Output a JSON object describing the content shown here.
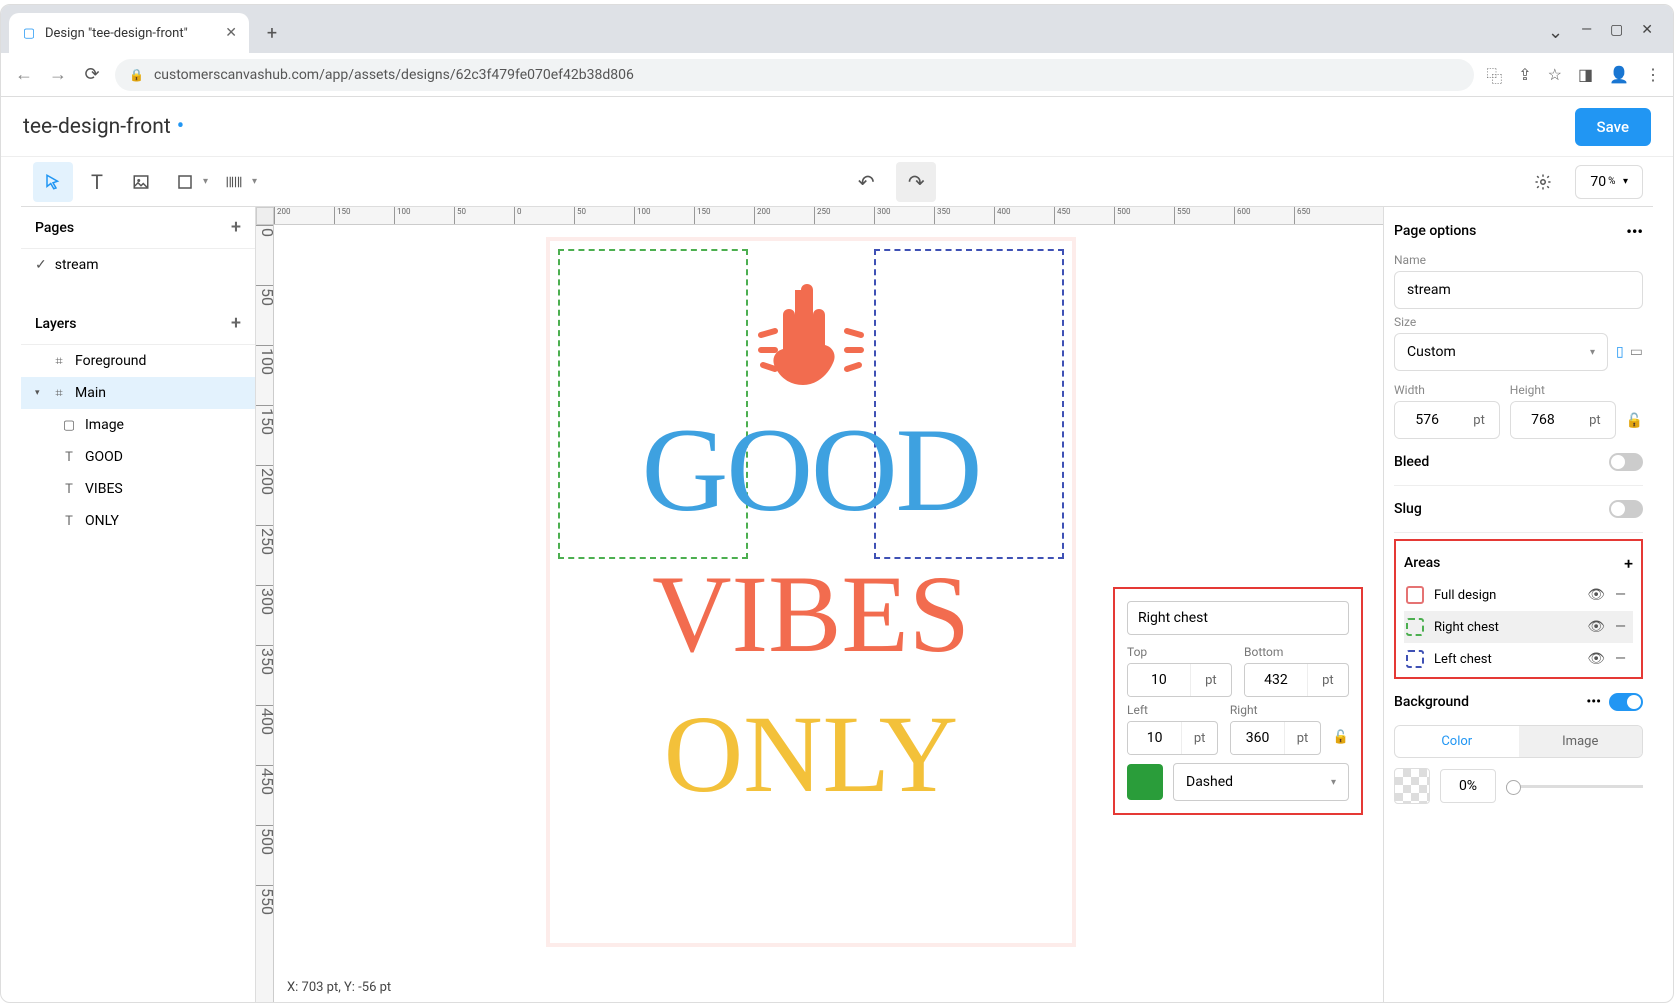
{
  "browser": {
    "tabTitle": "Design \"tee-design-front\"",
    "url": "customerscanvashub.com/app/assets/designs/62c3f479fe070ef42b38d806"
  },
  "header": {
    "title": "tee-design-front",
    "save": "Save"
  },
  "toolbar": {
    "zoom": "70",
    "zoomPct": "%"
  },
  "pagesPanel": {
    "title": "Pages",
    "items": [
      "stream"
    ]
  },
  "layersPanel": {
    "title": "Layers",
    "groups": [
      {
        "name": "Foreground"
      },
      {
        "name": "Main",
        "children": [
          {
            "icon": "rect",
            "name": "Image"
          },
          {
            "icon": "T",
            "name": "GOOD"
          },
          {
            "icon": "T",
            "name": "VIBES"
          },
          {
            "icon": "T",
            "name": "ONLY"
          }
        ]
      }
    ]
  },
  "canvas": {
    "good": "GOOD",
    "vibes": "VIBES",
    "only": "ONLY"
  },
  "floatPanel": {
    "name": "Right chest",
    "top": {
      "label": "Top",
      "value": "10",
      "unit": "pt"
    },
    "bottom": {
      "label": "Bottom",
      "value": "432",
      "unit": "pt"
    },
    "left": {
      "label": "Left",
      "value": "10",
      "unit": "pt"
    },
    "right": {
      "label": "Right",
      "value": "360",
      "unit": "pt"
    },
    "lineStyle": "Dashed"
  },
  "rightPanel": {
    "pageOptions": "Page options",
    "nameLabel": "Name",
    "nameValue": "stream",
    "sizeLabel": "Size",
    "sizeValue": "Custom",
    "widthLabel": "Width",
    "width": "576",
    "heightLabel": "Height",
    "height": "768",
    "unit": "pt",
    "bleed": "Bleed",
    "slug": "Slug",
    "areas": {
      "title": "Areas",
      "items": [
        {
          "label": "Full design"
        },
        {
          "label": "Right chest"
        },
        {
          "label": "Left chest"
        }
      ]
    },
    "background": {
      "title": "Background",
      "color": "Color",
      "image": "Image",
      "opacity": "0%"
    }
  },
  "coords": "X: 703 pt, Y: -56 pt"
}
